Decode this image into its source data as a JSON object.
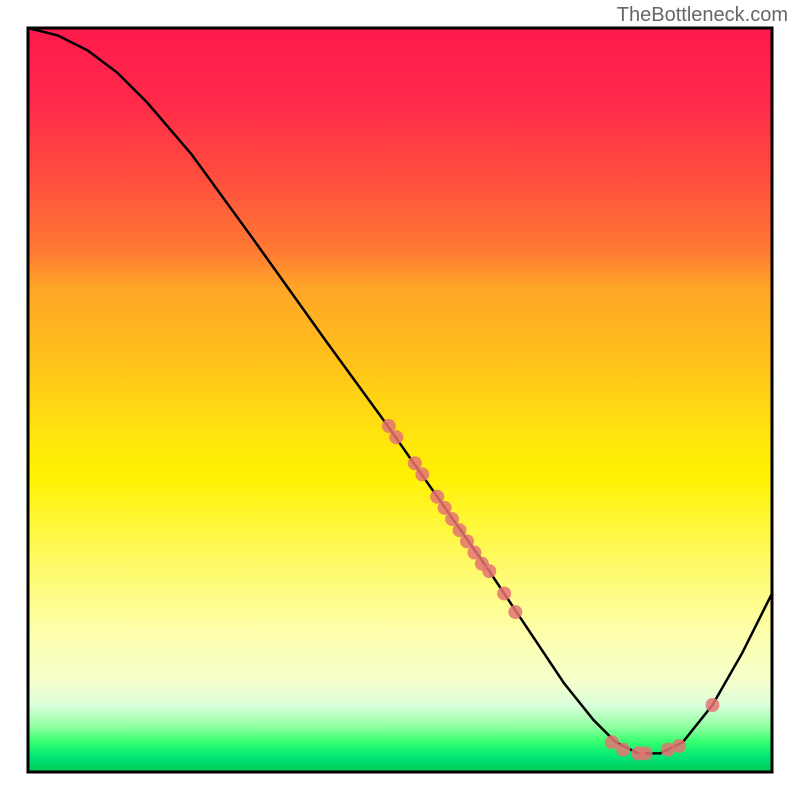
{
  "watermark": "TheBottleneck.com",
  "chart_data": {
    "type": "line",
    "title": "",
    "xlabel": "",
    "ylabel": "",
    "xlim": [
      0,
      100
    ],
    "ylim": [
      0,
      100
    ],
    "grid": false,
    "curve_points": [
      {
        "x": 0,
        "y": 100
      },
      {
        "x": 4,
        "y": 99
      },
      {
        "x": 8,
        "y": 97
      },
      {
        "x": 12,
        "y": 94
      },
      {
        "x": 16,
        "y": 90
      },
      {
        "x": 22,
        "y": 83
      },
      {
        "x": 30,
        "y": 72
      },
      {
        "x": 40,
        "y": 58
      },
      {
        "x": 48,
        "y": 47
      },
      {
        "x": 55,
        "y": 37
      },
      {
        "x": 62,
        "y": 27
      },
      {
        "x": 68,
        "y": 18
      },
      {
        "x": 72,
        "y": 12
      },
      {
        "x": 76,
        "y": 7
      },
      {
        "x": 79,
        "y": 4
      },
      {
        "x": 82,
        "y": 2.5
      },
      {
        "x": 85,
        "y": 2.5
      },
      {
        "x": 88,
        "y": 4
      },
      {
        "x": 92,
        "y": 9
      },
      {
        "x": 96,
        "y": 16
      },
      {
        "x": 100,
        "y": 24
      }
    ],
    "scatter_points": [
      {
        "x": 48.5,
        "y": 46.5
      },
      {
        "x": 49.5,
        "y": 45
      },
      {
        "x": 52,
        "y": 41.5
      },
      {
        "x": 53,
        "y": 40
      },
      {
        "x": 55,
        "y": 37
      },
      {
        "x": 56,
        "y": 35.5
      },
      {
        "x": 57,
        "y": 34
      },
      {
        "x": 58,
        "y": 32.5
      },
      {
        "x": 59,
        "y": 31
      },
      {
        "x": 60,
        "y": 29.5
      },
      {
        "x": 61,
        "y": 28
      },
      {
        "x": 62,
        "y": 27
      },
      {
        "x": 64,
        "y": 24
      },
      {
        "x": 65.5,
        "y": 21.5
      },
      {
        "x": 78.5,
        "y": 4
      },
      {
        "x": 80,
        "y": 3
      },
      {
        "x": 82,
        "y": 2.5
      },
      {
        "x": 83,
        "y": 2.5
      },
      {
        "x": 86,
        "y": 3
      },
      {
        "x": 87.5,
        "y": 3.5
      },
      {
        "x": 92,
        "y": 9
      }
    ]
  }
}
